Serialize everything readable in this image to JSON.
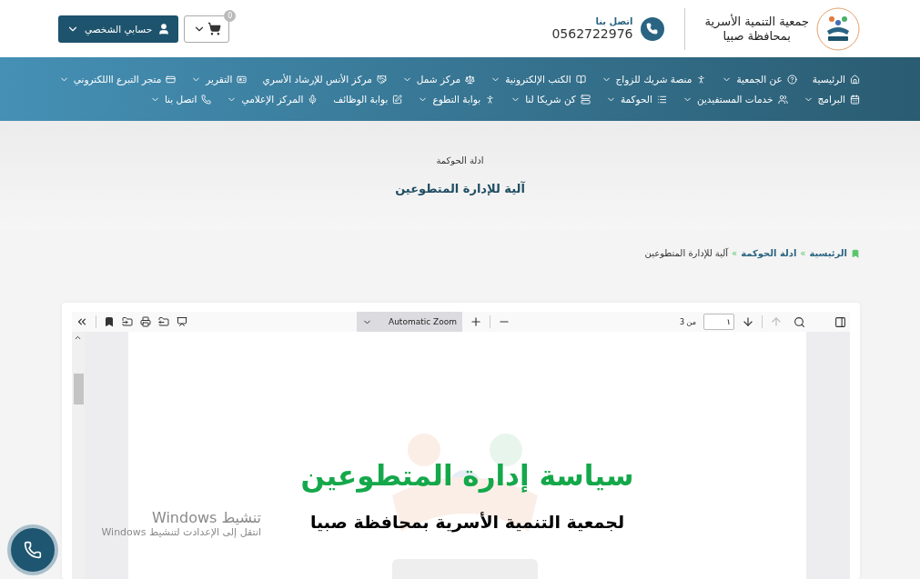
{
  "header": {
    "org_name": [
      "جمعية التنمية الأسرية",
      "بمحافظة صبيا"
    ],
    "contact": {
      "label": "اتصل بنا",
      "phone": "0562722976"
    },
    "account_button": {
      "label": "حسابي الشخصي"
    },
    "cart": {
      "count": "0"
    }
  },
  "nav": {
    "upper_row": [
      {
        "label": "الرئيسية",
        "dropdown": false
      },
      {
        "label": "عن الجمعية",
        "dropdown": true
      },
      {
        "label": "منصة شريك للزواج",
        "dropdown": true
      },
      {
        "label": "الكتب الإلكترونية",
        "dropdown": true
      },
      {
        "label": "مركز شمل",
        "dropdown": true
      },
      {
        "label": "مركز الأنس للإرشاد الأسري",
        "dropdown": false
      },
      {
        "label": "التقرير",
        "dropdown": true
      },
      {
        "label": "متجر التبرع االلكتروني",
        "dropdown": true
      }
    ],
    "lower_row": [
      {
        "label": "البرامج",
        "dropdown": true
      },
      {
        "label": "خدمات المستفيدين",
        "dropdown": true
      },
      {
        "label": "الحوكمة",
        "dropdown": true
      },
      {
        "label": "كن شريكا لنا",
        "dropdown": true
      },
      {
        "label": "بوابة التطوع",
        "dropdown": true
      },
      {
        "label": "بوابة الوظائف",
        "dropdown": false
      },
      {
        "label": "المركز الإعلامي",
        "dropdown": true
      },
      {
        "label": "اتصل بنا",
        "dropdown": true
      }
    ]
  },
  "page_header": {
    "subtitle": "ادلة الحوكمة",
    "title": "آلية للإدارة المتطوعين"
  },
  "breadcrumb": {
    "separator": "»",
    "items": [
      {
        "label": "الرئيسية",
        "current": false
      },
      {
        "label": "ادلة الحوكمة",
        "current": false
      },
      {
        "label": "آلية للإدارة المتطوعين",
        "current": true
      }
    ]
  },
  "pdf_viewer": {
    "toolbar": {
      "zoom": "Automatic Zoom",
      "page_input": "١",
      "page_total": "من 3",
      "previous_disabled": true,
      "next_disabled": false
    },
    "document": {
      "title": "سياسة إدارة المتطوعين",
      "subtitle": "لجمعية التنمية الأسرية بمحافظة صبيا"
    }
  },
  "windows_notice": {
    "title": "تنشيط Windows",
    "body": "انتقل إلى الإعدادت لتنشيط Windows"
  }
}
